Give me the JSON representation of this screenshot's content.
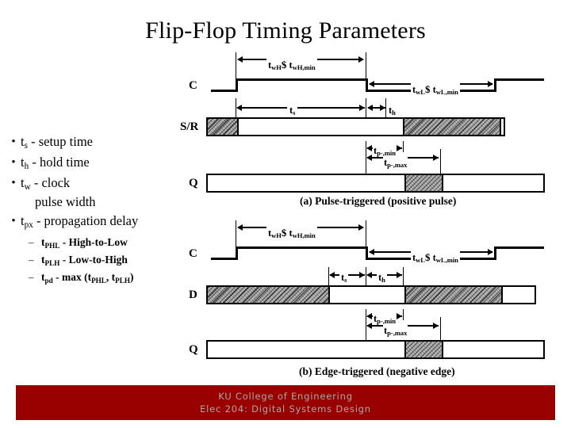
{
  "title": "Flip-Flop Timing Parameters",
  "bullets": [
    {
      "base": "t",
      "sub": "s",
      "rest": " - setup time"
    },
    {
      "base": "t",
      "sub": "h",
      "rest": " - hold time"
    },
    {
      "base": "t",
      "sub": "w",
      "rest": " - clock",
      "cont": "pulse width"
    },
    {
      "base": "t",
      "sub": "px",
      "rest": " - propagation delay"
    }
  ],
  "subbullets": [
    {
      "dash": "–",
      "base": "t",
      "sub": "PHL",
      "rest": " - High-to-Low"
    },
    {
      "dash": "–",
      "base": "t",
      "sub": "PLH",
      "rest": " - Low-to-High"
    },
    {
      "dash": "–",
      "base": "t",
      "sub": "pd",
      "rest": " - max (t",
      "sub2": "PHL",
      "mid": ", t",
      "sub3": "PLH",
      "tail": ")"
    }
  ],
  "diagram_a": {
    "caption": "(a) Pulse-triggered (positive pulse)",
    "signals": [
      "C",
      "S/R",
      "Q"
    ],
    "labels": {
      "twh": "t",
      "twh_sub": "wH",
      "twh_rel": "$",
      "twh_min": "t",
      "twh_min_sub": "wH,min",
      "twl": "t",
      "twl_sub": "wL",
      "twl_rel": "$",
      "twl_min": "t",
      "twl_min_sub": "wL,min",
      "ts": "t",
      "ts_sub": "s",
      "th": "t",
      "th_sub": "h",
      "tpmin": "t",
      "tpmin_sub": "p-,min",
      "tpmax": "t",
      "tpmax_sub": "p-,max"
    }
  },
  "diagram_b": {
    "caption": "(b) Edge-triggered (negative edge)",
    "signals": [
      "C",
      "D",
      "Q"
    ],
    "labels": {
      "twh": "t",
      "twh_sub": "wH",
      "twh_rel": "$",
      "twh_min": "t",
      "twh_min_sub": "wH,min",
      "twl": "t",
      "twl_sub": "wL",
      "twl_rel": "$",
      "twl_min": "t",
      "twl_min_sub": "wL,min",
      "ts": "t",
      "ts_sub": "s",
      "th": "t",
      "th_sub": "h",
      "tpmin": "t",
      "tpmin_sub": "p-,min",
      "tpmax": "t",
      "tpmax_sub": "p-,max"
    }
  },
  "footer": {
    "line1": "KU College of Engineering",
    "line2": "Elec 204: Digital Systems Design",
    "color": "#990000"
  }
}
